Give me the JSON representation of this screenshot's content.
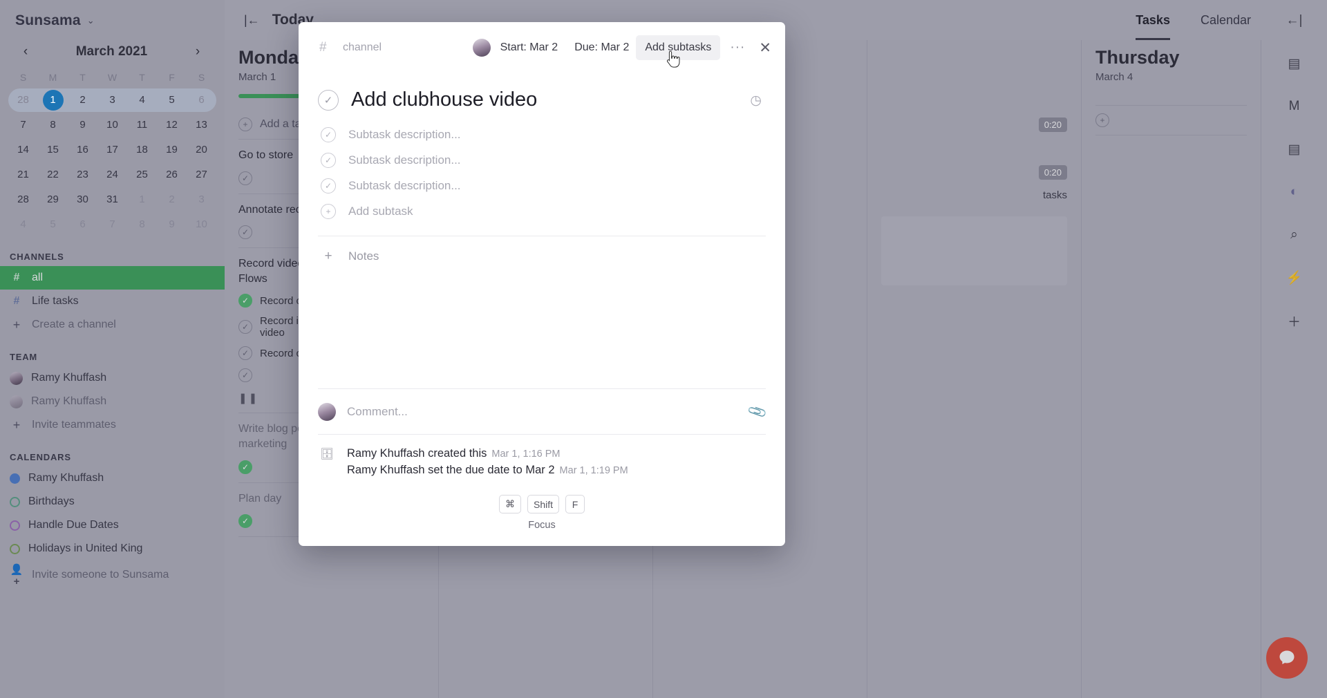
{
  "app": {
    "brand": "Sunsama",
    "brand_chevron": "⌄"
  },
  "calendar": {
    "month_title": "March 2021",
    "prev_icon": "‹",
    "next_icon": "›",
    "dow": [
      "S",
      "M",
      "T",
      "W",
      "T",
      "F",
      "S"
    ],
    "weeks": [
      [
        {
          "d": "28",
          "muted": true
        },
        {
          "d": "1",
          "today": true
        },
        {
          "d": "2"
        },
        {
          "d": "3"
        },
        {
          "d": "4"
        },
        {
          "d": "5"
        },
        {
          "d": "6",
          "muted": true
        }
      ],
      [
        {
          "d": "7"
        },
        {
          "d": "8"
        },
        {
          "d": "9"
        },
        {
          "d": "10"
        },
        {
          "d": "11"
        },
        {
          "d": "12"
        },
        {
          "d": "13"
        }
      ],
      [
        {
          "d": "14"
        },
        {
          "d": "15"
        },
        {
          "d": "16"
        },
        {
          "d": "17"
        },
        {
          "d": "18"
        },
        {
          "d": "19"
        },
        {
          "d": "20"
        }
      ],
      [
        {
          "d": "21"
        },
        {
          "d": "22"
        },
        {
          "d": "23"
        },
        {
          "d": "24"
        },
        {
          "d": "25"
        },
        {
          "d": "26"
        },
        {
          "d": "27"
        }
      ],
      [
        {
          "d": "28"
        },
        {
          "d": "29"
        },
        {
          "d": "30"
        },
        {
          "d": "31"
        },
        {
          "d": "1",
          "muted": true
        },
        {
          "d": "2",
          "muted": true
        },
        {
          "d": "3",
          "muted": true
        }
      ],
      [
        {
          "d": "4",
          "muted": true
        },
        {
          "d": "5",
          "muted": true
        },
        {
          "d": "6",
          "muted": true
        },
        {
          "d": "7",
          "muted": true
        },
        {
          "d": "8",
          "muted": true
        },
        {
          "d": "9",
          "muted": true
        },
        {
          "d": "10",
          "muted": true
        }
      ]
    ]
  },
  "sidebar": {
    "channels_label": "CHANNELS",
    "channels": [
      {
        "icon": "#",
        "label": "all",
        "active": true
      },
      {
        "icon": "#",
        "label": "Life tasks",
        "active": false
      },
      {
        "icon": "+",
        "label": "Create a channel",
        "active": false
      }
    ],
    "team_label": "TEAM",
    "team": [
      {
        "label": "Ramy Khuffash",
        "kind": "avatar"
      },
      {
        "label": "Ramy Khuffash",
        "kind": "avatar-faded"
      },
      {
        "label": "Invite teammates",
        "kind": "plus"
      }
    ],
    "calendars_label": "CALENDARS",
    "calendars": [
      {
        "label": "Ramy Khuffash",
        "color": "#4f7fd0",
        "filled": true
      },
      {
        "label": "Birthdays",
        "color": "#5fa58d",
        "filled": false
      },
      {
        "label": "Handle Due Dates",
        "color": "#a06ec0",
        "filled": false
      },
      {
        "label": "Holidays in United King",
        "color": "#7aa05a",
        "filled": false
      }
    ],
    "invite": {
      "label": "Invite someone to Sunsama",
      "icon": "person-plus-icon"
    }
  },
  "topbar": {
    "collapse_icon": "|←",
    "today_label": "Today",
    "nav": [
      {
        "label": "Tasks",
        "selected": true
      },
      {
        "label": "Calendar",
        "selected": false
      }
    ],
    "expand_icon": "←|"
  },
  "days": [
    {
      "name": "Monday",
      "date": "March 1",
      "progress_pct": 33,
      "add_task": "Add a task",
      "cards": [
        {
          "title": "Go to store",
          "dim": false
        },
        {
          "title": "Annotate recorded",
          "dim": false
        },
        {
          "title": "Record videos for P\nFlows",
          "dim": false,
          "subs": [
            {
              "text": "Record onboar",
              "done": true
            },
            {
              "text": "Record inviting\nvideo",
              "done": false
            },
            {
              "text": "Record creating",
              "done": false
            }
          ]
        },
        {
          "title": "Write blog post abo\nmarketing",
          "dim": true
        },
        {
          "title": "Plan day",
          "dim": true
        }
      ],
      "pause_icon": "❚❚"
    },
    {
      "name": "",
      "date": "",
      "chips": [
        "0:20",
        "0:20"
      ],
      "tasks_label": "tasks"
    },
    {
      "name": "Thursday",
      "date": "March 4",
      "add_icon": "+"
    }
  ],
  "rail": {
    "icons": [
      "collapse-right-icon",
      "inbox-icon",
      "mail-icon",
      "archive-icon",
      "focus-icon",
      "search-icon",
      "bolt-icon",
      "plus-icon"
    ]
  },
  "chat_button": {
    "name": "intercom-chat-button",
    "color": "#e0503f"
  },
  "modal": {
    "header": {
      "hash": "#",
      "channel_placeholder": "channel",
      "start": "Start: Mar 2",
      "due": "Due: Mar 2",
      "add_subtasks": "Add subtasks",
      "more": "···",
      "close": "✕"
    },
    "task": {
      "title": "Add clubhouse video",
      "subtasks": [
        "Subtask description...",
        "Subtask description...",
        "Subtask description..."
      ],
      "add_subtask": "Add subtask",
      "notes": "Notes"
    },
    "comment": {
      "placeholder": "Comment...",
      "attach_icon": "attachment-icon"
    },
    "activity": [
      {
        "text": "Ramy Khuffash created this",
        "time": "Mar 1, 1:16 PM"
      },
      {
        "text": "Ramy Khuffash set the due date to Mar 2",
        "time": "Mar 1, 1:19 PM"
      }
    ],
    "footer": {
      "keys": [
        "⌘",
        "Shift",
        "F"
      ],
      "label": "Focus"
    }
  }
}
